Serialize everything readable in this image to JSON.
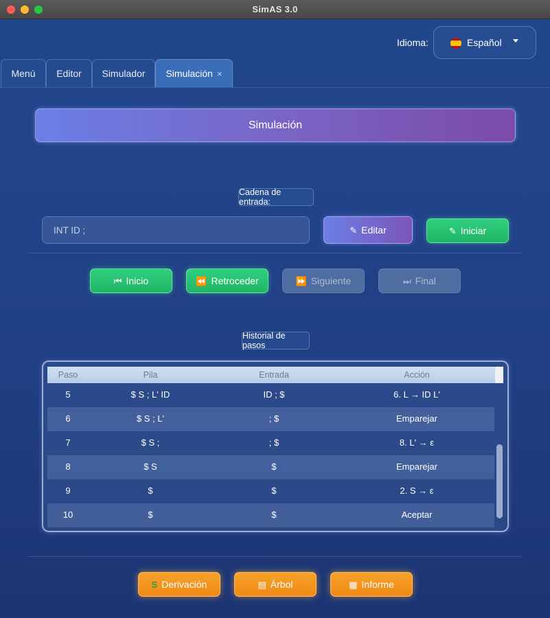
{
  "window": {
    "title": "SimAS 3.0"
  },
  "language": {
    "label": "Idioma:",
    "value": "Español"
  },
  "tabs": [
    {
      "label": "Menú",
      "active": false
    },
    {
      "label": "Editor",
      "active": false
    },
    {
      "label": "Simulador",
      "active": false
    },
    {
      "label": "Simulación",
      "active": true,
      "close": "×"
    }
  ],
  "header": {
    "title": "Simulación"
  },
  "input_section": {
    "label": "Cadena de entrada:",
    "value": "INT ID ;",
    "edit_label": "Editar",
    "start_label": "Iniciar"
  },
  "controls": {
    "inicio": "Inicio",
    "retroceder": "Retroceder",
    "siguiente": "Siguiente",
    "final": "Final"
  },
  "history": {
    "label": "Historial de pasos",
    "columns": [
      "Paso",
      "Pila",
      "Entrada",
      "Acción"
    ],
    "rows": [
      {
        "paso": "5",
        "pila": "$ S ; L' ID",
        "entrada": "ID ; $",
        "accion": "6. L → ID L'"
      },
      {
        "paso": "6",
        "pila": "$ S ; L'",
        "entrada": "; $",
        "accion": "Emparejar"
      },
      {
        "paso": "7",
        "pila": "$ S ;",
        "entrada": "; $",
        "accion": "8. L' → ε"
      },
      {
        "paso": "8",
        "pila": "$ S",
        "entrada": "$",
        "accion": "Emparejar"
      },
      {
        "paso": "9",
        "pila": "$",
        "entrada": "$",
        "accion": "2. S → ε"
      },
      {
        "paso": "10",
        "pila": "$",
        "entrada": "$",
        "accion": "Aceptar"
      }
    ]
  },
  "footer": {
    "derivacion": "Derivación",
    "arbol": "Árbol",
    "informe": "Informe"
  },
  "colors": {
    "accent_green": "#2fd07e",
    "accent_orange": "#f7a22a",
    "accent_purple": "#7a63c3"
  }
}
